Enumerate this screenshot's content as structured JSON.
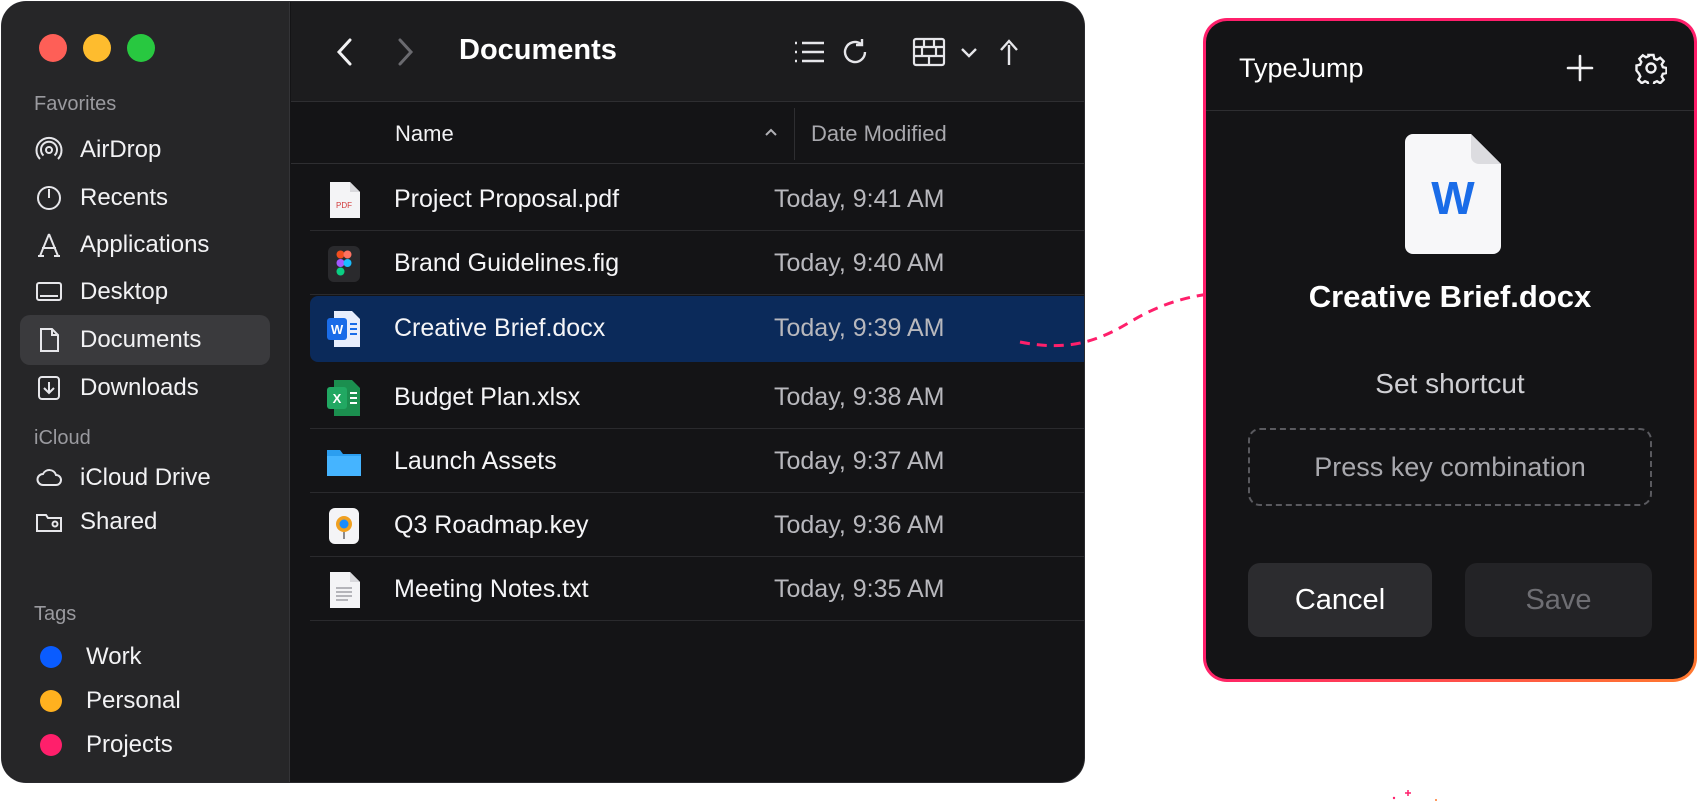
{
  "finder": {
    "title": "Documents",
    "sidebar": {
      "favorites_label": "Favorites",
      "favorites": [
        {
          "label": "AirDrop",
          "icon": "airdrop-icon"
        },
        {
          "label": "Recents",
          "icon": "clock-icon"
        },
        {
          "label": "Applications",
          "icon": "applications-icon"
        },
        {
          "label": "Desktop",
          "icon": "desktop-icon"
        },
        {
          "label": "Documents",
          "icon": "document-icon",
          "active": true
        },
        {
          "label": "Downloads",
          "icon": "download-icon"
        }
      ],
      "icloud_label": "iCloud",
      "icloud": [
        {
          "label": "iCloud Drive",
          "icon": "cloud-icon"
        },
        {
          "label": "Shared",
          "icon": "shared-folder-icon"
        }
      ],
      "tags_label": "Tags",
      "tags": [
        {
          "label": "Work",
          "color": "#0a5cff"
        },
        {
          "label": "Personal",
          "color": "#ffb11f"
        },
        {
          "label": "Projects",
          "color": "#ff1f6b"
        }
      ]
    },
    "columns": {
      "name": "Name",
      "date": "Date Modified"
    },
    "files": [
      {
        "name": "Project Proposal.pdf",
        "date": "Today, 9:41 AM",
        "icon": "pdf-file-icon",
        "icon_text": "PDF"
      },
      {
        "name": "Brand Guidelines.fig",
        "date": "Today, 9:40 AM",
        "icon": "figma-file-icon"
      },
      {
        "name": "Creative Brief.docx",
        "date": "Today, 9:39 AM",
        "icon": "word-file-icon",
        "icon_text": "W",
        "selected": true
      },
      {
        "name": "Budget Plan.xlsx",
        "date": "Today, 9:38 AM",
        "icon": "excel-file-icon",
        "icon_text": "X"
      },
      {
        "name": "Launch Assets",
        "date": "Today, 9:37 AM",
        "icon": "folder-icon"
      },
      {
        "name": "Q3 Roadmap.key",
        "date": "Today, 9:36 AM",
        "icon": "keynote-file-icon"
      },
      {
        "name": "Meeting Notes.txt",
        "date": "Today, 9:35 AM",
        "icon": "text-file-icon"
      }
    ]
  },
  "typejump": {
    "title": "TypeJump",
    "doc_icon_letter": "W",
    "doc_name": "Creative Brief.docx",
    "shortcut_label": "Set shortcut",
    "shortcut_placeholder": "Press key combination",
    "cancel_label": "Cancel",
    "save_label": "Save"
  },
  "colors": {
    "accent_pink": "#ff1f6b",
    "accent_orange": "#ff7a2e",
    "selection_blue": "#0b2a5a",
    "word_blue": "#1a6ce8"
  }
}
